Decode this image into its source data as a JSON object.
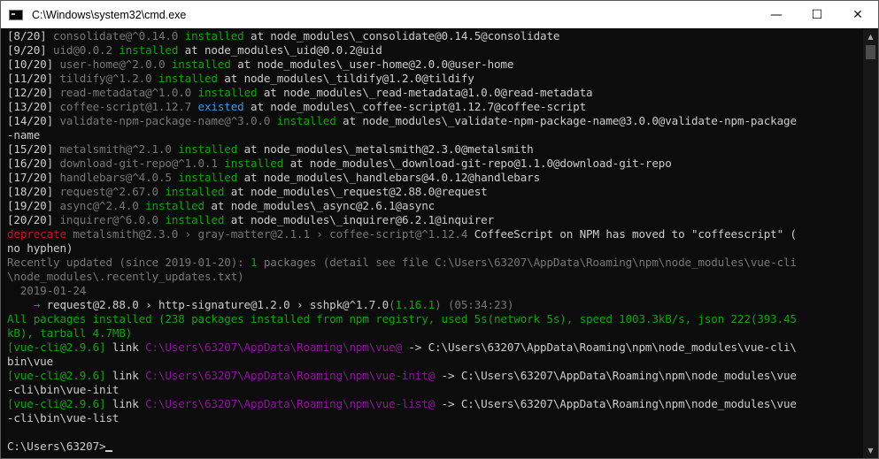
{
  "window": {
    "title": "C:\\Windows\\system32\\cmd.exe",
    "minimize_glyph": "—",
    "maximize_glyph": "☐",
    "close_glyph": "✕"
  },
  "scrollbar": {
    "up_glyph": "▲",
    "down_glyph": "▼"
  },
  "terminal": {
    "l01": {
      "a": "[8/20] ",
      "b": "consolidate@^0.14.0 ",
      "c": "installed",
      "d": " at node_modules\\_consolidate@0.14.5@consolidate"
    },
    "l02": {
      "a": "[9/20] ",
      "b": "uid@0.0.2 ",
      "c": "installed",
      "d": " at node_modules\\_uid@0.0.2@uid"
    },
    "l03": {
      "a": "[10/20] ",
      "b": "user-home@^2.0.0 ",
      "c": "installed",
      "d": " at node_modules\\_user-home@2.0.0@user-home"
    },
    "l04": {
      "a": "[11/20] ",
      "b": "tildify@^1.2.0 ",
      "c": "installed",
      "d": " at node_modules\\_tildify@1.2.0@tildify"
    },
    "l05": {
      "a": "[12/20] ",
      "b": "read-metadata@^1.0.0 ",
      "c": "installed",
      "d": " at node_modules\\_read-metadata@1.0.0@read-metadata"
    },
    "l06": {
      "a": "[13/20] ",
      "b": "coffee-script@1.12.7 ",
      "c": "existed",
      "d": " at node_modules\\_coffee-script@1.12.7@coffee-script"
    },
    "l07": {
      "a": "[14/20] ",
      "b": "validate-npm-package-name@^3.0.0 ",
      "c": "installed",
      "d": " at node_modules\\_validate-npm-package-name@3.0.0@validate-npm-package"
    },
    "l08": {
      "a": "-name"
    },
    "l09": {
      "a": "[15/20] ",
      "b": "metalsmith@^2.1.0 ",
      "c": "installed",
      "d": " at node_modules\\_metalsmith@2.3.0@metalsmith"
    },
    "l10": {
      "a": "[16/20] ",
      "b": "download-git-repo@^1.0.1 ",
      "c": "installed",
      "d": " at node_modules\\_download-git-repo@1.1.0@download-git-repo"
    },
    "l11": {
      "a": "[17/20] ",
      "b": "handlebars@^4.0.5 ",
      "c": "installed",
      "d": " at node_modules\\_handlebars@4.0.12@handlebars"
    },
    "l12": {
      "a": "[18/20] ",
      "b": "request@^2.67.0 ",
      "c": "installed",
      "d": " at node_modules\\_request@2.88.0@request"
    },
    "l13": {
      "a": "[19/20] ",
      "b": "async@^2.4.0 ",
      "c": "installed",
      "d": " at node_modules\\_async@2.6.1@async"
    },
    "l14": {
      "a": "[20/20] ",
      "b": "inquirer@^6.0.0 ",
      "c": "installed",
      "d": " at node_modules\\_inquirer@6.2.1@inquirer"
    },
    "l15": {
      "a": "deprecate",
      "b": " metalsmith@2.3.0 › gray-matter@2.1.1 › coffee-script@^1.12.4 ",
      "c": "CoffeeScript on NPM has moved to \"coffeescript\" ("
    },
    "l16": {
      "a": "no hyphen)"
    },
    "l17": {
      "a": "Recently updated (since 2019-01-20): ",
      "b": "1",
      "c": " packages (detail see file C:\\Users\\63207\\AppData\\Roaming\\npm\\node_modules\\vue-cli"
    },
    "l18": {
      "a": "\\node_modules\\.recently_updates.txt)"
    },
    "l19": {
      "a": "  2019-01-24"
    },
    "l20": {
      "a": "    → ",
      "b": "request@2.88.0 › http-signature@1.2.0 › sshpk@^1.7.0",
      "c": "(",
      "d": "1.16.1",
      "e": ")",
      "f": " (05:34:23)"
    },
    "l21": {
      "a": "All packages installed (238 packages installed from npm registry, used 5s(network 5s), speed 1003.3kB/s, json 222(393.45"
    },
    "l22": {
      "a": "kB), tarball 4.7MB)"
    },
    "l23": {
      "a": "[vue-cli@2.9.6]",
      "b": " link ",
      "c": "C:\\Users\\63207\\AppData\\Roaming\\npm\\vue@",
      "d": " -> C:\\Users\\63207\\AppData\\Roaming\\npm\\node_modules\\vue-cli\\"
    },
    "l24": {
      "a": "bin\\vue"
    },
    "l25": {
      "a": "[vue-cli@2.9.6]",
      "b": " link ",
      "c": "C:\\Users\\63207\\AppData\\Roaming\\npm\\vue-init@",
      "d": " -> C:\\Users\\63207\\AppData\\Roaming\\npm\\node_modules\\vue"
    },
    "l26": {
      "a": "-cli\\bin\\vue-init"
    },
    "l27": {
      "a": "[vue-cli@2.9.6]",
      "b": " link ",
      "c": "C:\\Users\\63207\\AppData\\Roaming\\npm\\vue-list@",
      "d": " -> C:\\Users\\63207\\AppData\\Roaming\\npm\\node_modules\\vue"
    },
    "l28": {
      "a": "-cli\\bin\\vue-list"
    },
    "l29": {
      "a": ""
    },
    "l30": {
      "a": "C:\\Users\\63207>"
    }
  },
  "colors": {
    "background": "#0c0c0c",
    "foreground": "#cccccc",
    "green": "#13a10e",
    "gray": "#767676",
    "cyan": "#3a96dd",
    "magenta": "#881798",
    "red": "#c50f1f",
    "light_yellow": "#f9f1a5"
  }
}
